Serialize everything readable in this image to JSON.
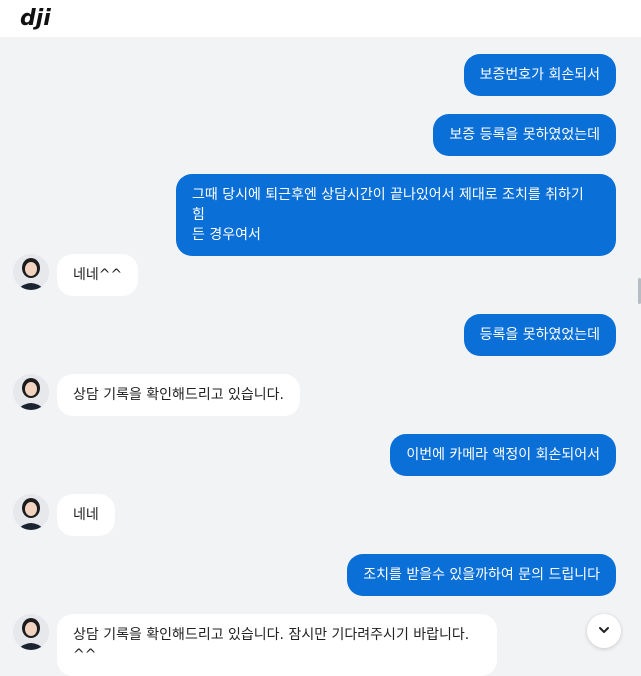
{
  "header": {
    "logo_text": "dji",
    "logo_icon": "dji-logo-icon"
  },
  "messages": [
    {
      "sender": "user",
      "text": "보증번호가 회손되서"
    },
    {
      "sender": "user",
      "text": "보증 등록을 못하였었는데"
    },
    {
      "sender": "user",
      "text": "그때 당시에 퇴근후엔 상담시간이 끝나있어서 제대로 조치를 취하기 힘\n든 경우여서"
    },
    {
      "sender": "agent",
      "text": "네네^^"
    },
    {
      "sender": "user",
      "text": "등록을 못하였었는데"
    },
    {
      "sender": "agent",
      "text": "상담 기록을 확인해드리고 있습니다."
    },
    {
      "sender": "user",
      "text": "이번에 카메라 액정이 회손되어서"
    },
    {
      "sender": "agent",
      "text": "네네"
    },
    {
      "sender": "user",
      "text": "조치를 받을수 있을까하여 문의 드립니다"
    },
    {
      "sender": "agent",
      "text": "상담 기록을 확인해드리고 있습니다. 잠시만 기다려주시기 바랍니다.\n^^"
    }
  ],
  "controls": {
    "scroll_down_icon": "chevron-down-icon",
    "avatar_icon": "agent-avatar"
  },
  "colors": {
    "user_bubble": "#0a6fd6",
    "agent_bubble": "#ffffff",
    "background": "#f2f3f5"
  }
}
